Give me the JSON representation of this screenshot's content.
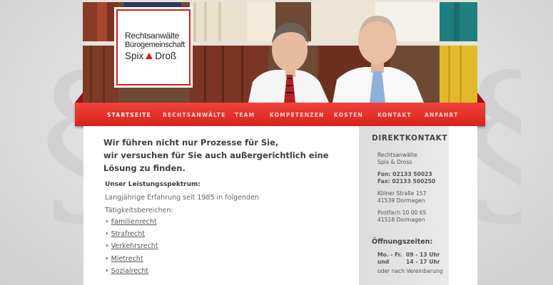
{
  "logo": {
    "line1": "Rechtsanwälte",
    "line2": "Bürogemeinschaft",
    "name_left": "Spix",
    "name_right": "Droß",
    "accent_color": "#d21a1a"
  },
  "nav": {
    "items": [
      {
        "label": "STARTSEITE",
        "active": true
      },
      {
        "label": "RECHTSANWÄLTE",
        "active": false
      },
      {
        "label": "TEAM",
        "active": false
      },
      {
        "label": "KOMPETENZEN",
        "active": false
      },
      {
        "label": "KOSTEN",
        "active": false
      },
      {
        "label": "KONTAKT",
        "active": false
      },
      {
        "label": "ANFAHRT",
        "active": false
      }
    ],
    "color": "#e0302a"
  },
  "main": {
    "headline": [
      "Wir führen nicht nur Prozesse für Sie,",
      "wir versuchen für Sie auch außergerichtlich eine",
      "Lösung zu finden."
    ],
    "subheading": "Unser Leistungsspektrum:",
    "description": [
      "Langjährige Erfahrung seit 1985 in folgenden",
      "Tätigkeitsbereichen:"
    ],
    "links": [
      "Familienrecht",
      "Strafrecht",
      "Verkehrsrecht",
      "Mietrecht",
      "Sozialrecht"
    ],
    "bullet": "•"
  },
  "sidebar": {
    "title": "DIREKTKONTAKT",
    "firm_line1": "Rechtsanwälte",
    "firm_line2": "Spix & Dross",
    "phone": "Fon: 02133 50023",
    "fax": "Fax: 02133 500250",
    "street": "Kölner Straße 157",
    "city": "41539 Dormagen",
    "pobox": "Postfach 10 00 65",
    "pobox_city": "41518 Dormagen",
    "hours_title": "Öffnungszeiten:",
    "hours": [
      {
        "days": "Mo. - Fr.",
        "time": "09 - 13 Uhr"
      },
      {
        "days": "und",
        "time": "14 - 17 Uhr"
      }
    ],
    "hours_note": "oder nach Vereinbarung"
  }
}
